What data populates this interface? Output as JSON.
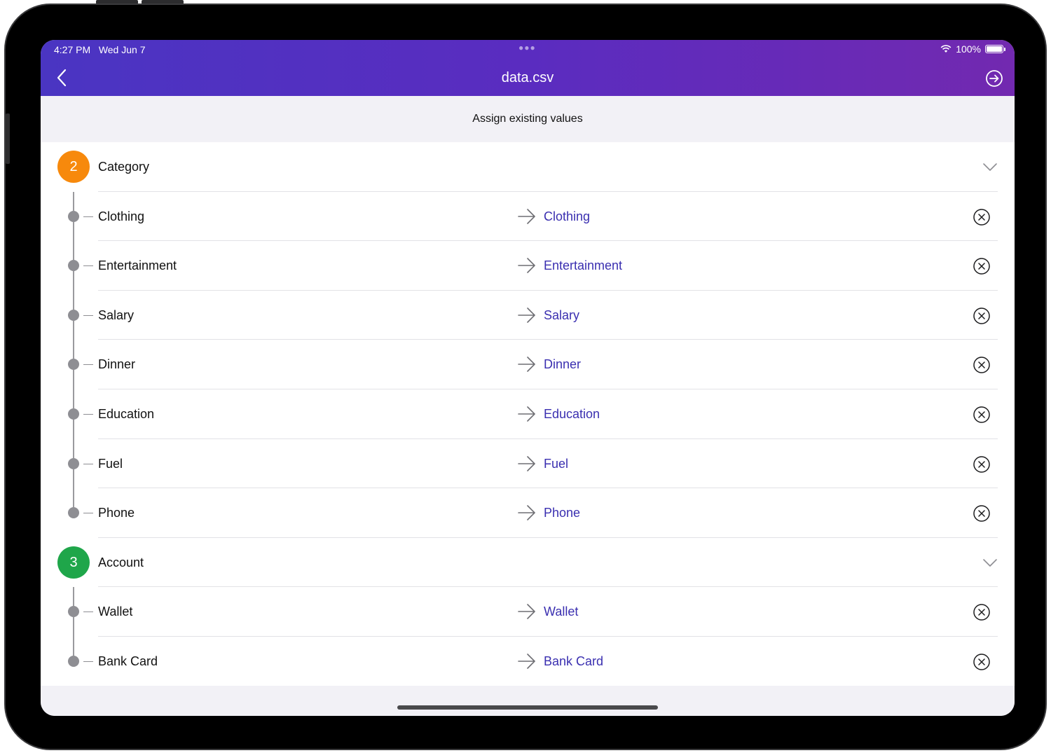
{
  "status_bar": {
    "time": "4:27 PM",
    "date": "Wed Jun 7",
    "battery": "100%",
    "wifi_icon": "wifi-icon",
    "battery_icon": "battery-icon"
  },
  "nav": {
    "title": "data.csv",
    "back_icon": "chevron-left-icon",
    "action_icon": "arrow-right-circle-icon"
  },
  "subtitle": "Assign existing values",
  "colors": {
    "header_gradient_start": "#4a35c2",
    "header_gradient_end": "#7229b0",
    "category_badge": "#f7890c",
    "account_badge": "#1fa64a",
    "link": "#3a2fb0"
  },
  "groups": [
    {
      "number": "2",
      "label": "Category",
      "items": [
        {
          "source": "Clothing",
          "target": "Clothing"
        },
        {
          "source": "Entertainment",
          "target": "Entertainment"
        },
        {
          "source": "Salary",
          "target": "Salary"
        },
        {
          "source": "Dinner",
          "target": "Dinner"
        },
        {
          "source": "Education",
          "target": "Education"
        },
        {
          "source": "Fuel",
          "target": "Fuel"
        },
        {
          "source": "Phone",
          "target": "Phone"
        }
      ]
    },
    {
      "number": "3",
      "label": "Account",
      "items": [
        {
          "source": "Wallet",
          "target": "Wallet"
        },
        {
          "source": "Bank Card",
          "target": "Bank Card"
        }
      ]
    }
  ]
}
